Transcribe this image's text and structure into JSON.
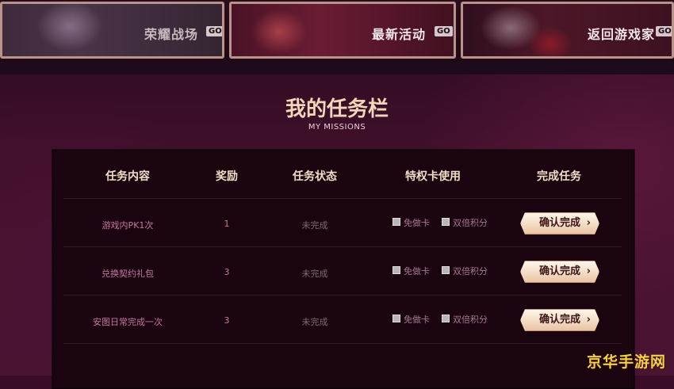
{
  "nav": {
    "banners": [
      {
        "label": "荣耀战场",
        "go": "GO"
      },
      {
        "label": "最新活动",
        "go": "GO"
      },
      {
        "label": "返回游戏家",
        "go": "GO"
      }
    ]
  },
  "header": {
    "title": "我的任务栏",
    "subtitle": "MY MISSIONS"
  },
  "table": {
    "columns": [
      "任务内容",
      "奖励",
      "任务状态",
      "特权卡使用",
      "完成任务"
    ],
    "card_labels": [
      "免做卡",
      "双倍积分"
    ],
    "rows": [
      {
        "task": "游戏内PK1次",
        "reward": "1",
        "status": "未完成",
        "button": "确认完成"
      },
      {
        "task": "兑换契约礼包",
        "reward": "3",
        "status": "未完成",
        "button": "确认完成"
      },
      {
        "task": "安图日常完成一次",
        "reward": "3",
        "status": "未完成",
        "button": "确认完成"
      }
    ]
  },
  "watermark": "京华手游网"
}
